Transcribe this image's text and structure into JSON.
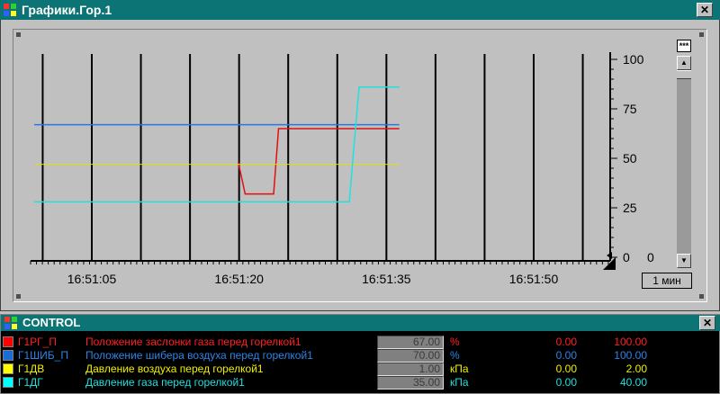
{
  "window1": {
    "title": "Графики.Гор.1",
    "close_label": "✕",
    "scroll_label": "***",
    "span_label": "1 мин"
  },
  "chart_data": {
    "type": "line",
    "x": [
      "16:51:05",
      "16:51:20",
      "16:51:35",
      "16:51:50"
    ],
    "xlabel": "",
    "ylabel": "",
    "y_ticks": [
      "100",
      "75",
      "50",
      "25",
      "0"
    ],
    "y_zero_label": "0",
    "ylim": [
      0,
      100
    ],
    "grid": "vertical",
    "background": "#c0c0c0",
    "series": [
      {
        "color": "#e01010",
        "points": [
          [
            16.2,
            48
          ],
          [
            16.9,
            32
          ],
          [
            19.8,
            32
          ],
          [
            20.3,
            65
          ],
          [
            32.6,
            65
          ]
        ]
      },
      {
        "color": "#2878e0",
        "points": [
          [
            0,
            67
          ],
          [
            32.6,
            67
          ]
        ]
      },
      {
        "color": "#e0e000",
        "points": [
          [
            0,
            47
          ],
          [
            32.6,
            47
          ]
        ]
      },
      {
        "color": "#20e0e0",
        "points": [
          [
            0,
            28
          ],
          [
            27.5,
            28
          ],
          [
            28.5,
            86
          ],
          [
            32.6,
            86
          ]
        ]
      }
    ]
  },
  "window2": {
    "title": "CONTROL",
    "close_label": "✕",
    "rows": [
      {
        "tag": "Г1РГ_П",
        "desc": "Положение заслонки газа перед горелкой1",
        "value": "67.00",
        "unit": "%",
        "min": "0.00",
        "max": "100.00",
        "color": "#ff2020",
        "swatch": "#ff0000"
      },
      {
        "tag": "Г1ШИБ_П",
        "desc": "Положение шибера воздуха перед горелкой1",
        "value": "70.00",
        "unit": "%",
        "min": "0.00",
        "max": "100.00",
        "color": "#2c84e8",
        "swatch": "#1c6cd8"
      },
      {
        "tag": "Г1ДВ",
        "desc": "Давление воздуха перед горелкой1",
        "value": "1.00",
        "unit": "кПа",
        "min": "0.00",
        "max": "2.00",
        "color": "#f0f000",
        "swatch": "#ffff00"
      },
      {
        "tag": "Г1ДГ",
        "desc": "Давление газа перед горелкой1",
        "value": "35.00",
        "unit": "кПа",
        "min": "0.00",
        "max": "40.00",
        "color": "#20e0e0",
        "swatch": "#00ffff"
      }
    ]
  }
}
